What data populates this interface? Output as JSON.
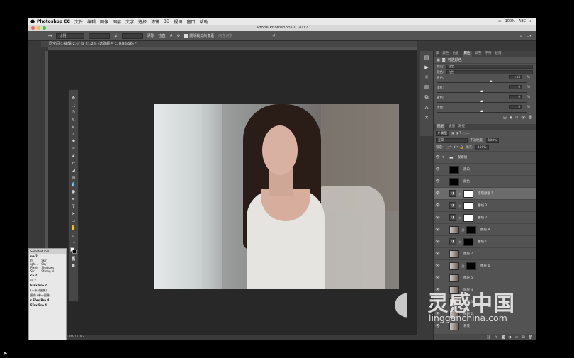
{
  "menubar": {
    "app": "Photoshop CC",
    "items": [
      "文件",
      "编辑",
      "图像",
      "图层",
      "文字",
      "选择",
      "滤镜",
      "3D",
      "视图",
      "窗口",
      "帮助"
    ],
    "status": [
      "100%",
      "ABC"
    ]
  },
  "window": {
    "title": "Adobe Photoshop CC 2017"
  },
  "options": {
    "ratio": "比例",
    "clear": "清除",
    "straighten": "拉直",
    "delete_cropped": "删除裁剪的像素",
    "content_aware": "内容识别"
  },
  "document": {
    "tab": "一同空间-1-编辑-2.tif @ 21.2% (选取颜色 1, RGB/16) *",
    "status": "文档:243.8M/1.01G"
  },
  "panel_tabs": [
    "库",
    "颜色",
    "色板",
    "属性",
    "调整",
    "字符",
    "段落"
  ],
  "properties": {
    "title": "可选颜色",
    "preset_label": "预设:",
    "preset_value": "自定",
    "color_label": "颜色:",
    "color_value": "白色",
    "sliders": [
      {
        "label": "青色:",
        "value": "+14",
        "pct": 0.6
      },
      {
        "label": "洋红:",
        "value": "0",
        "pct": 0.5
      },
      {
        "label": "黄色:",
        "value": "0",
        "pct": 0.5
      },
      {
        "label": "黑色:",
        "value": "0",
        "pct": 0.5
      }
    ],
    "unit": "%"
  },
  "layer_tabs": [
    "图层",
    "通道",
    "路径"
  ],
  "layer_controls": {
    "kind": "P 类型",
    "blend": "正常",
    "opacity_label": "不透明度:",
    "opacity": "100%",
    "lock_label": "锁定:",
    "fill_label": "填充:",
    "fill": "100%"
  },
  "layers": [
    {
      "name": "观察组",
      "type": "group",
      "thumb": ""
    },
    {
      "name": "黑白",
      "type": "thumb",
      "thumb": "#000000"
    },
    {
      "name": "颜色",
      "type": "thumb",
      "thumb": "#000000"
    },
    {
      "name": "选取颜色 1",
      "type": "adj",
      "thumb": "#ffffff",
      "selected": true
    },
    {
      "name": "曲线 3",
      "type": "adj",
      "thumb": "#ffffff"
    },
    {
      "name": "曲线 2",
      "type": "adj",
      "thumb": "#ffffff"
    },
    {
      "name": "图层 8",
      "type": "photo",
      "thumb": "#000000"
    },
    {
      "name": "曲线 1",
      "type": "adj",
      "thumb": "#000000"
    },
    {
      "name": "图层 7",
      "type": "photo",
      "thumb": ""
    },
    {
      "name": "图层 6",
      "type": "photo",
      "thumb": "#000000"
    },
    {
      "name": "图层 5",
      "type": "photo",
      "thumb": ""
    },
    {
      "name": "图层 4",
      "type": "photo",
      "thumb": ""
    },
    {
      "name": "图层 3",
      "type": "photo",
      "thumb": ""
    },
    {
      "name": "图层 2",
      "type": "photo",
      "thumb": ""
    },
    {
      "name": "背景",
      "type": "photo",
      "thumb": ""
    }
  ],
  "preset_panel": {
    "title": "Selected Tool",
    "rows": [
      "ne 2"
    ],
    "cols": [
      [
        "Skin",
        "Sky",
        "Shadows",
        "Strong N..."
      ],
      [
        "ht",
        "ighl...",
        "Pixels",
        "Str..."
      ]
    ],
    "items": [
      "ca 2",
      "re 2",
      "Efex Pro 2",
      "(一系列图像)",
      "图像 (单一图像)",
      "r Efex Pro 4",
      "Efex Pro 4"
    ]
  },
  "watermark": {
    "brand": "灵感中国",
    "url": "lingganchina.com"
  }
}
